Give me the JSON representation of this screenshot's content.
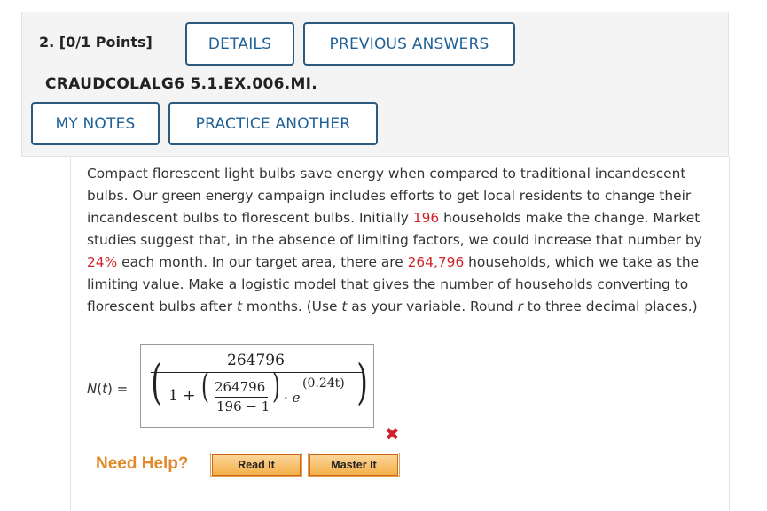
{
  "question": {
    "number_label": "2.  [0/1 Points]",
    "details_label": "DETAILS",
    "previous_answers_label": "PREVIOUS ANSWERS",
    "code": "CRAUDCOLALG6 5.1.EX.006.MI.",
    "my_notes_label": "MY NOTES",
    "practice_another_label": "PRACTICE ANOTHER"
  },
  "problem": {
    "part1": "Compact florescent light bulbs save energy when compared to traditional incandescent bulbs. Our green energy campaign includes efforts to get local residents to change their incandescent bulbs to florescent bulbs. Initially ",
    "initial_households": "196",
    "part2": " households make the change. Market studies suggest that, in the absence of limiting factors, we could increase that number by ",
    "growth_rate": "24%",
    "part3": " each month. In our target area, there are ",
    "total_households": "264,796",
    "part4": " households, which we take as the limiting value. Make a logistic model that gives the number of households converting to florescent bulbs after ",
    "var_t1": "t",
    "part5": " months. (Use ",
    "var_t2": "t",
    "part6": " as your variable. Round ",
    "var_r": "r",
    "part7": " to three decimal places.)"
  },
  "answer": {
    "label_fn": "N",
    "label_open": "(",
    "label_var": "t",
    "label_close": ") =",
    "numerator": "264796",
    "one_plus": "1 +",
    "inner_numerator": "264796",
    "inner_denominator": "196 − 1",
    "dot": "·",
    "e": "e",
    "exponent": "(0.24t)",
    "status": "incorrect",
    "status_icon": "✖"
  },
  "help": {
    "label": "Need Help?",
    "read_it": "Read It",
    "master_it": "Master It"
  },
  "colors": {
    "button_border": "#2b5a7e",
    "button_text": "#1f6197",
    "highlight_red": "#d0242c",
    "help_orange": "#e28a2b"
  }
}
